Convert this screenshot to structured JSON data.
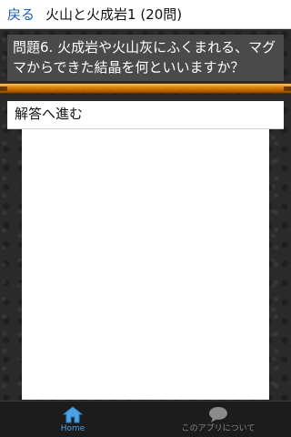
{
  "header": {
    "back_label": "戻る",
    "title": "火山と火成岩1 (20問)"
  },
  "question": {
    "text": "問題6. 火成岩や火山灰にふくまれる、マグマからできた結晶を何といいますか？"
  },
  "answer_button": {
    "label": "解答へ進む"
  },
  "bottom_nav": {
    "items": [
      {
        "label": "Home",
        "icon": "home-icon",
        "active": true,
        "color": "#4aa3e6"
      },
      {
        "label": "このアプリについて",
        "icon": "speech-bubble-icon",
        "active": false,
        "color": "#8a8a8a"
      }
    ]
  }
}
